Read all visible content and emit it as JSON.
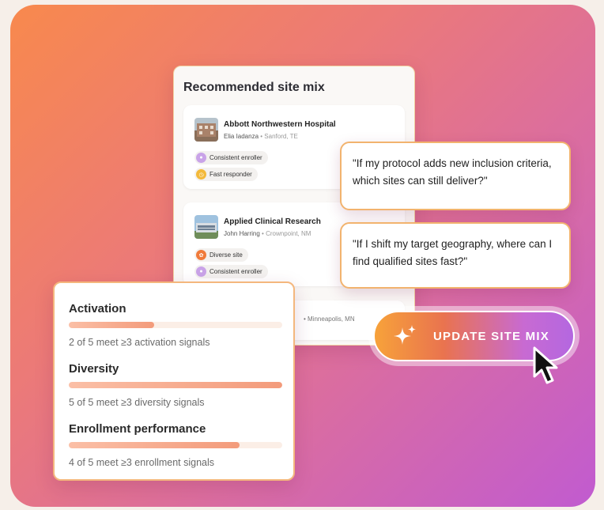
{
  "panel": {
    "title": "Recommended site mix",
    "sites": [
      {
        "name": "Abbott Northwestern Hospital",
        "contact": "Elia Iadanza",
        "location": "Sanford, TE",
        "tags": [
          {
            "label": "Consistent enroller",
            "icon": "enroller-icon",
            "color": "#c9a3e8"
          },
          {
            "label": "Fast responder",
            "icon": "clock-icon",
            "color": "#f3b93a"
          }
        ]
      },
      {
        "name": "Applied Clinical Research",
        "contact": "John Harring",
        "location": "Crownpoint, NM",
        "tags": [
          {
            "label": "Diverse site",
            "icon": "diversity-icon",
            "color": "#f07a3a"
          },
          {
            "label": "Consistent enroller",
            "icon": "enroller-icon",
            "color": "#c9a3e8"
          }
        ]
      },
      {
        "location": "Minneapolis, MN"
      }
    ]
  },
  "quotes": [
    "\"If my protocol adds new inclusion criteria, which sites can still deliver?\"",
    "\"If I shift my target geography, where can I find qualified sites fast?\""
  ],
  "update_button": {
    "label": "UPDATE SITE MIX",
    "icon": "sparkle-icon"
  },
  "signals": [
    {
      "title": "Activation",
      "description": "2 of 5 meet ≥3 activation signals",
      "progress": 0.4
    },
    {
      "title": "Diversity",
      "description": "5 of 5 meet ≥3 diversity signals",
      "progress": 1.0
    },
    {
      "title": "Enrollment performance",
      "description": "4 of 5 meet ≥3 enrollment signals",
      "progress": 0.8
    }
  ],
  "colors": {
    "accent_orange": "#f7a23a",
    "accent_purple": "#b467e0",
    "border_peach": "#f4b77d"
  }
}
